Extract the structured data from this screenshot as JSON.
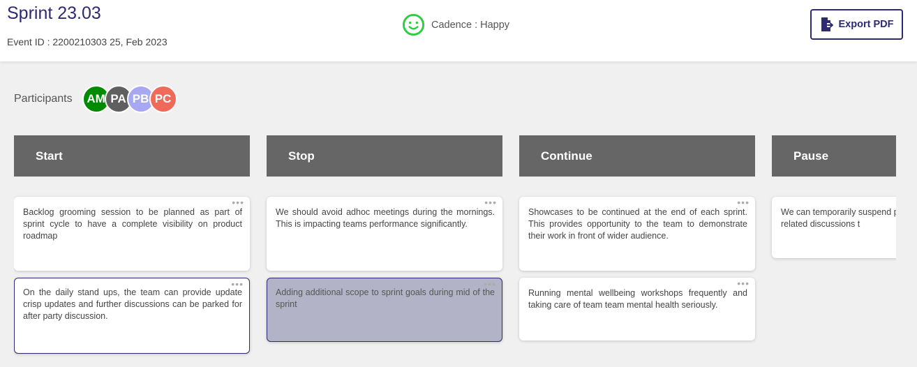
{
  "header": {
    "title": "Sprint 23.03",
    "event_info": "Event ID : 2200210303  25, Feb 2023",
    "cadence_label": "Cadence : Happy",
    "cadence_icon": "smiley-icon",
    "export_label": "Export PDF"
  },
  "participants": {
    "label": "Participants",
    "avatars": [
      {
        "initials": "AM",
        "color": "#008a00"
      },
      {
        "initials": "PA",
        "color": "#5f5f5f"
      },
      {
        "initials": "PB",
        "color": "#a7a7f2"
      },
      {
        "initials": "PC",
        "color": "#f06a5a"
      }
    ]
  },
  "columns": [
    {
      "title": "Start",
      "cards": [
        {
          "text": "Backlog grooming session to be planned as part of sprint cycle to have a complete visibility on product roadmap"
        },
        {
          "text": "On the daily stand ups, the team can provide update crisp updates and further discussions can be parked for after party discussion."
        }
      ]
    },
    {
      "title": "Stop",
      "cards": [
        {
          "text": "We should avoid adhoc meetings during the mornings. This is impacting teams performance significantly."
        },
        {
          "text": "Adding additional scope to sprint goals during mid of the sprint"
        }
      ]
    },
    {
      "title": "Continue",
      "cards": [
        {
          "text": "Showcases to be continued at the end of each sprint. This provides opportunity to the team to demonstrate their work in front of wider audience."
        },
        {
          "text": "Running mental wellbeing workshops frequently and taking care of team team mental health seriously."
        }
      ]
    },
    {
      "title": "Pause",
      "cards": [
        {
          "text": "We can temporarily suspend product related discussions t"
        }
      ]
    }
  ],
  "card_menu_glyph": "•••",
  "colors": {
    "accent": "#2e2a72",
    "column_header": "#666666",
    "happy": "#2ecc40"
  }
}
